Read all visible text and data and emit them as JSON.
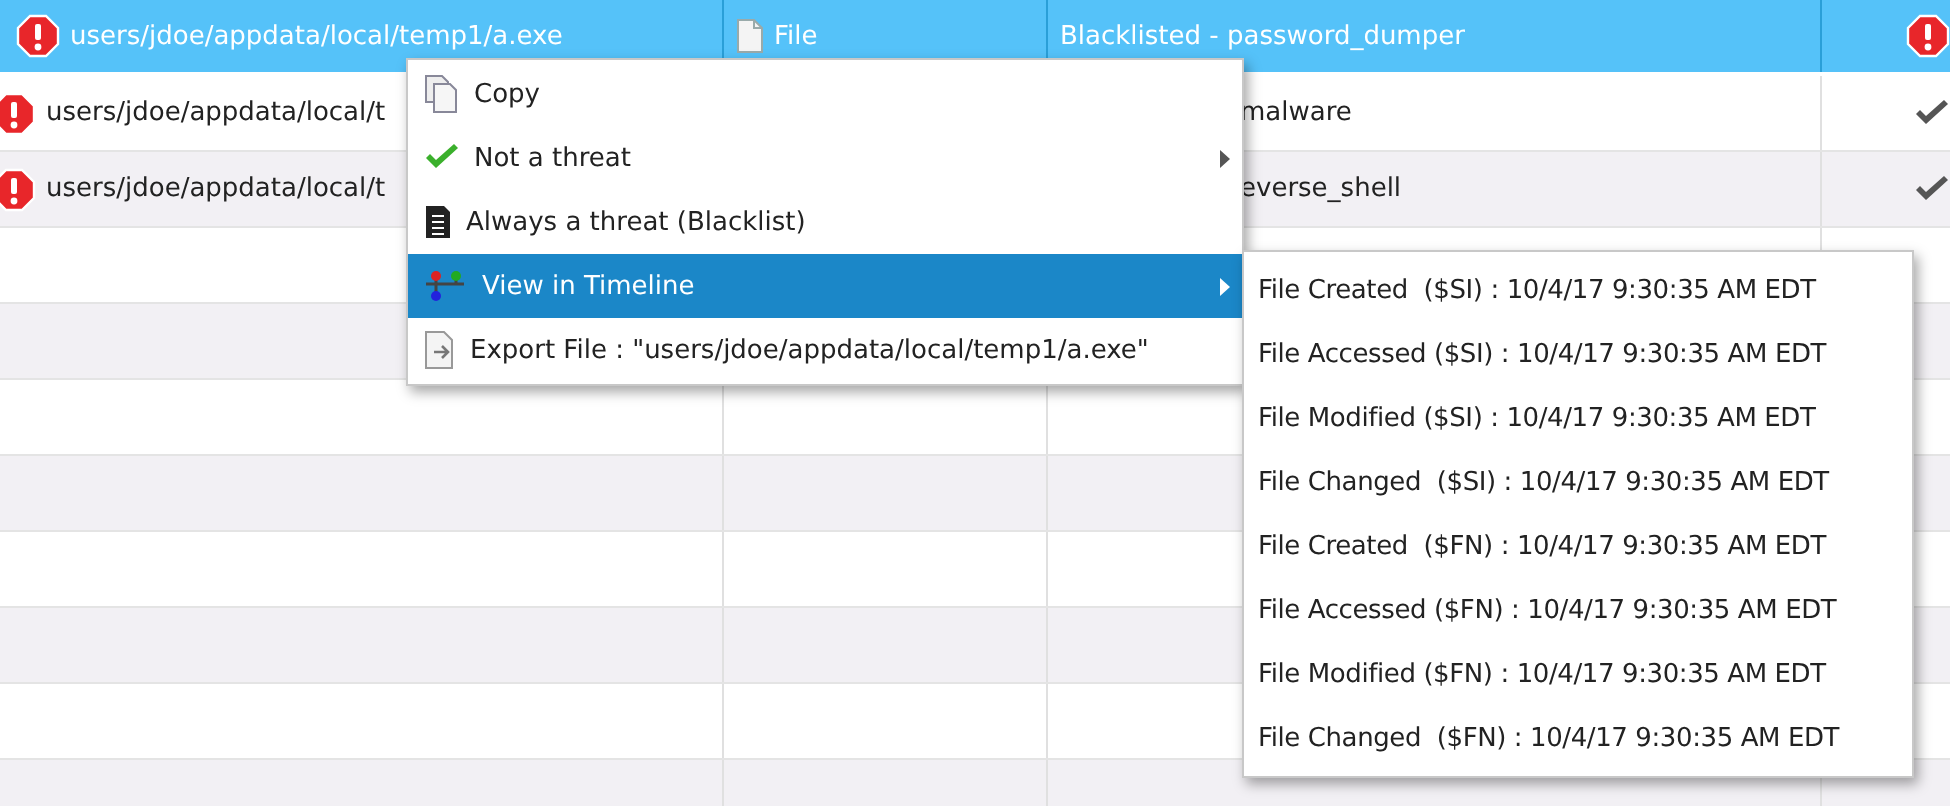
{
  "table": {
    "rows": [
      {
        "selected": true,
        "kind": "threat",
        "path": "users/jdoe/appdata/local/temp1/a.exe",
        "type": "File",
        "reason": "Blacklisted - password_dumper",
        "reason_partly_hidden": false
      },
      {
        "selected": false,
        "kind": "ok",
        "path": "users/jdoe/appdata/local/t",
        "reason": "malware",
        "reason_partly_hidden": true
      },
      {
        "selected": false,
        "kind": "ok",
        "path": "users/jdoe/appdata/local/t",
        "reason": "everse_shell",
        "reason_partly_hidden": true
      }
    ]
  },
  "context_menu": {
    "items": [
      {
        "kind": "copy",
        "label": "Copy",
        "submenu": false,
        "selected": false
      },
      {
        "kind": "check",
        "label": "Not a threat",
        "submenu": true,
        "selected": false
      },
      {
        "kind": "document",
        "label": "Always a threat (Blacklist)",
        "submenu": false,
        "selected": false
      },
      {
        "kind": "timeline",
        "label": "View in Timeline",
        "submenu": true,
        "selected": true
      },
      {
        "kind": "export",
        "label": "Export File : \"users/jdoe/appdata/local/temp1/a.exe\"",
        "submenu": false,
        "selected": false
      }
    ]
  },
  "submenu": {
    "items": [
      "File Created  ($SI) : 10/4/17 9:30:35 AM EDT",
      "File Accessed ($SI) : 10/4/17 9:30:35 AM EDT",
      "File Modified ($SI) : 10/4/17 9:30:35 AM EDT",
      "File Changed  ($SI) : 10/4/17 9:30:35 AM EDT",
      "File Created  ($FN) : 10/4/17 9:30:35 AM EDT",
      "File Accessed ($FN) : 10/4/17 9:30:35 AM EDT",
      "File Modified ($FN) : 10/4/17 9:30:35 AM EDT",
      "File Changed  ($FN) : 10/4/17 9:30:35 AM EDT"
    ]
  }
}
